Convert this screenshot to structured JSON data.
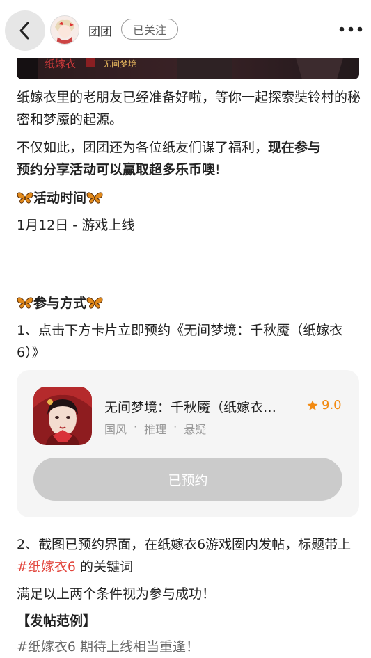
{
  "header": {
    "author_name": "团团",
    "follow_label": "已关注"
  },
  "banner": {
    "title_text": "纸嫁衣",
    "subtitle_text": "无间梦境"
  },
  "content": {
    "intro": "纸嫁衣里的老朋友已经准备好啦，等你一起探索奘铃村的秘密和梦魇的起源。",
    "welfare_line1_normal": "不仅如此，团团还为各位纸友们谋了福利，",
    "welfare_line1_bold": "现在参与",
    "welfare_line2_bold": "预约分享活动可以赢取超多乐币噢",
    "welfare_line2_tail": "!",
    "activity_time_title": "活动时间",
    "activity_time_detail": "1月12日 - 游戏上线",
    "participate_title": "参与方式",
    "step1": "1、点击下方卡片立即预约《无间梦境：千秋魇（纸嫁衣6）》",
    "step2_before": "2、截图已预约界面，在纸嫁衣6游戏圈内发帖，标题带上 ",
    "step2_hashtag": "#纸嫁衣6",
    "step2_after": " 的关键词",
    "success_note": "满足以上两个条件视为参与成功！",
    "example_title": "【发帖范例】",
    "example_partial": "#纸嫁衣6 期待上线相当重逢！"
  },
  "game_card": {
    "name": "无间梦境：千秋魇（纸嫁衣…",
    "rating": "9.0",
    "tags": [
      "国风",
      "·",
      "推理",
      "·",
      "悬疑"
    ],
    "reserve_label": "已预约"
  },
  "colors": {
    "accent": "#f28a12",
    "hashtag": "#e2453c",
    "button_disabled": "#cbcbcb"
  },
  "icons": [
    "back-arrow-icon",
    "more-dots-icon",
    "butterfly-icon",
    "star-icon"
  ]
}
